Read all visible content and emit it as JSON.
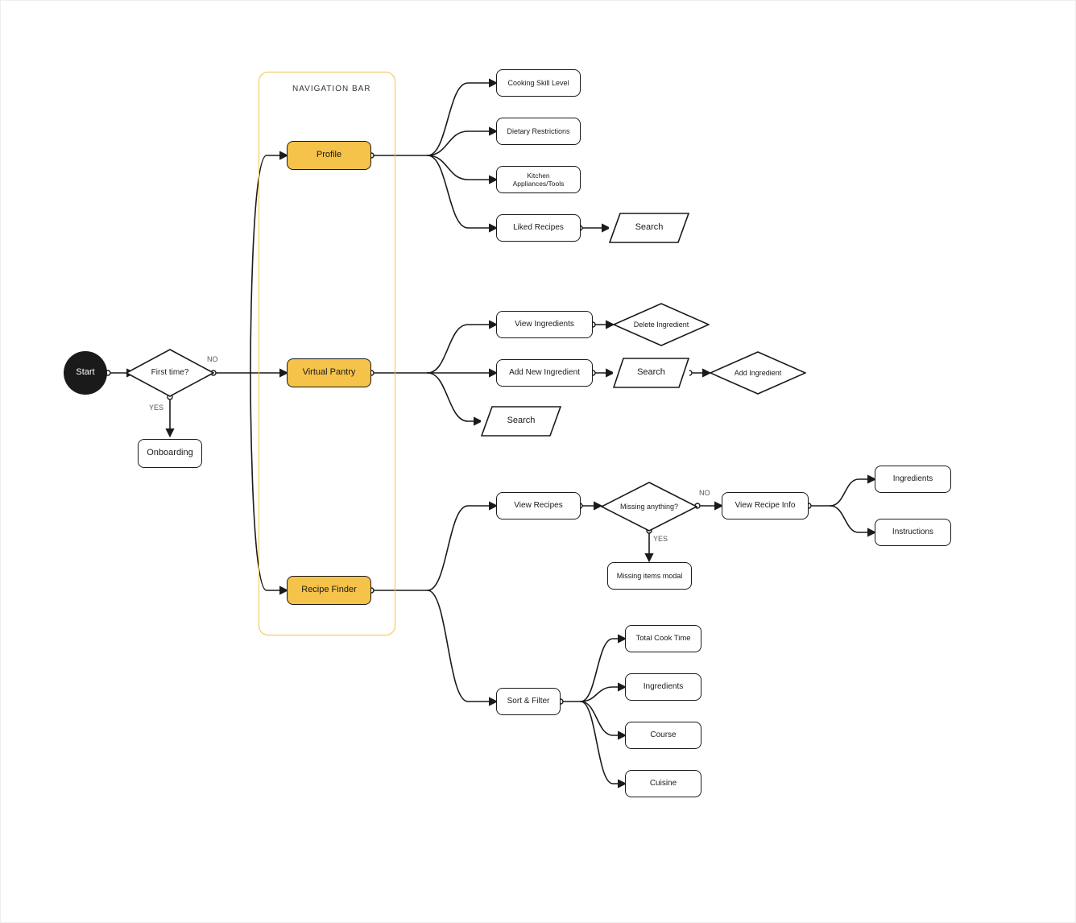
{
  "start": {
    "label": "Start"
  },
  "decision_first_time": {
    "label": "First time?",
    "yes": "YES",
    "no": "NO"
  },
  "onboarding": {
    "label": "Onboarding"
  },
  "nav_group_title": "NAVIGATION BAR",
  "nav": {
    "profile": "Profile",
    "virtual_pantry": "Virtual Pantry",
    "recipe_finder": "Recipe Finder"
  },
  "profile_children": {
    "skill": "Cooking Skill Level",
    "diet": "Dietary Restrictions",
    "tools": "Kitchen Appliances/Tools",
    "liked": "Liked Recipes"
  },
  "profile_liked_search": "Search",
  "pantry_children": {
    "view": "View Ingredients",
    "add": "Add New Ingredient",
    "search": "Search"
  },
  "pantry_delete": "Delete Ingredient",
  "pantry_add_search": "Search",
  "pantry_add_ingredient": "Add Ingredient",
  "recipe_children": {
    "view": "View Recipes",
    "sort": "Sort & Filter"
  },
  "recipe_view_missing_q": {
    "label": "Missing anything?",
    "yes": "YES",
    "no": "NO"
  },
  "recipe_missing_modal": "Missing items modal",
  "recipe_view_info": "View Recipe Info",
  "recipe_info_children": {
    "ingredients": "Ingredients",
    "instructions": "Instructions"
  },
  "sort_filter_children": {
    "time": "Total Cook Time",
    "ingredients": "Ingredients",
    "course": "Course",
    "cuisine": "Cuisine"
  }
}
